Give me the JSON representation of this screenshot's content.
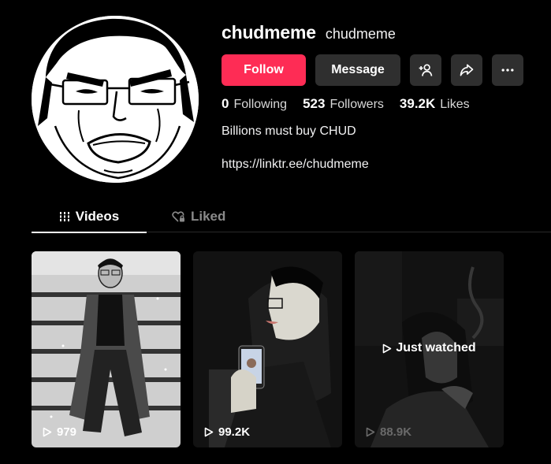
{
  "profile": {
    "username": "chudmeme",
    "nickname": "chudmeme",
    "bio": "Billions must buy CHUD",
    "link": "https://linktr.ee/chudmeme"
  },
  "actions": {
    "follow_label": "Follow",
    "message_label": "Message",
    "add_friend_icon": "person-plus-icon",
    "share_icon": "share-icon",
    "more_icon": "more-icon"
  },
  "stats": {
    "following_count": "0",
    "following_label": "Following",
    "followers_count": "523",
    "followers_label": "Followers",
    "likes_count": "39.2K",
    "likes_label": "Likes"
  },
  "tabs": [
    {
      "label": "Videos",
      "icon": "grid-icon",
      "active": true
    },
    {
      "label": "Liked",
      "icon": "heart-lock-icon",
      "active": false
    }
  ],
  "videos": [
    {
      "views": "979"
    },
    {
      "views": "99.2K"
    },
    {
      "views": "88.9K",
      "overlay": "Just watched"
    }
  ],
  "colors": {
    "accent": "#fe2c55",
    "button_dark": "#2f2f2f",
    "background": "#000000"
  }
}
